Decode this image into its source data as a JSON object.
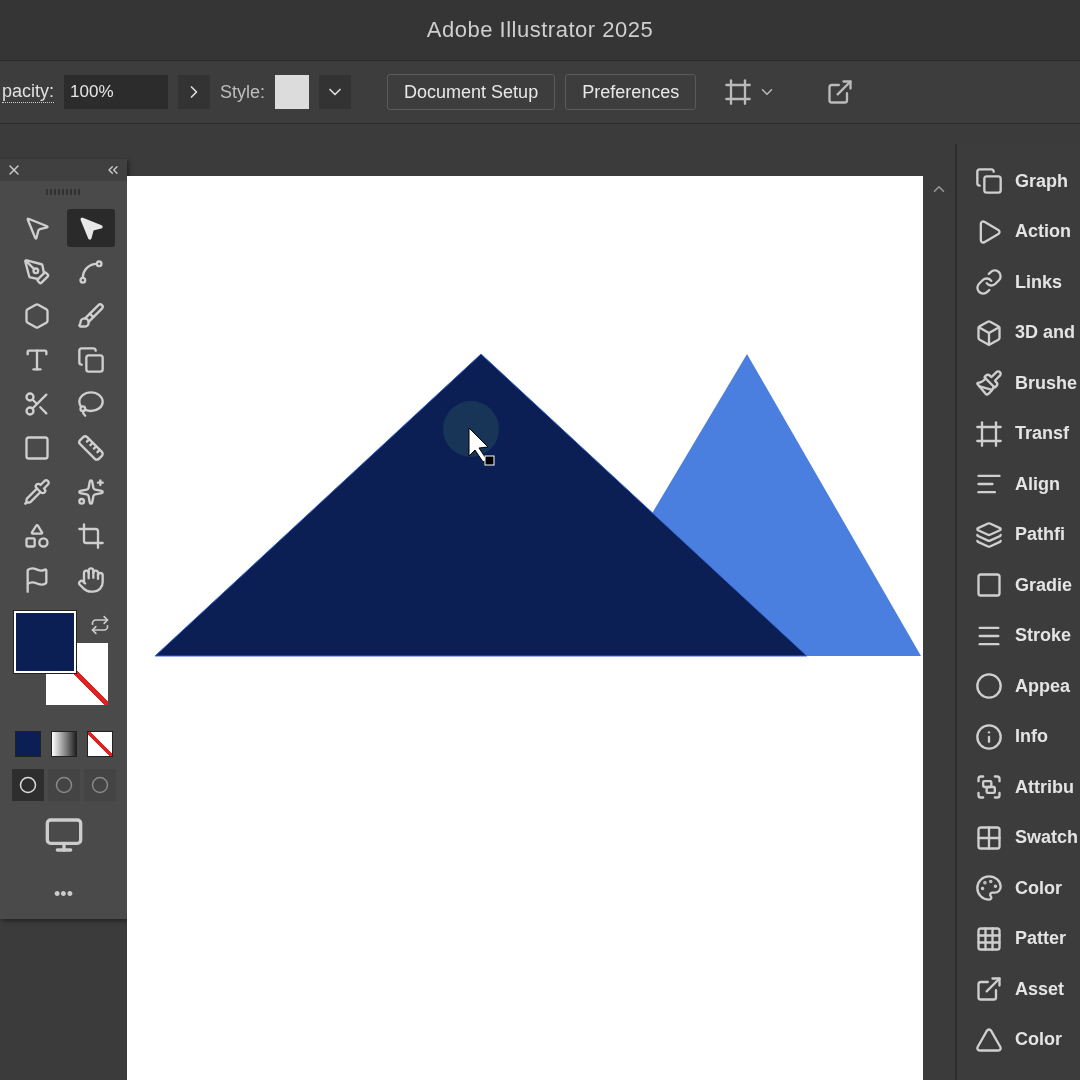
{
  "window": {
    "title": "Adobe Illustrator 2025"
  },
  "control_bar": {
    "opacity_label": "pacity:",
    "opacity_value": "100%",
    "style_label": "Style:",
    "buttons": [
      "Document Setup",
      "Preferences"
    ]
  },
  "tools": [
    {
      "selected": false
    },
    {
      "selected": true
    },
    {
      "selected": false
    },
    {
      "selected": false
    },
    {
      "selected": false
    },
    {
      "selected": false
    },
    {
      "selected": false
    },
    {
      "selected": false
    },
    {
      "selected": false
    },
    {
      "selected": false
    },
    {
      "selected": false
    },
    {
      "selected": false
    },
    {
      "selected": false
    },
    {
      "selected": false
    },
    {
      "selected": false
    },
    {
      "selected": false
    },
    {
      "selected": false
    },
    {
      "selected": false
    }
  ],
  "draw_modes": [
    {
      "selected": true
    },
    {
      "selected": false
    },
    {
      "selected": false
    }
  ],
  "more_label": "•••",
  "panels": [
    {
      "label": "Graph"
    },
    {
      "label": "Action"
    },
    {
      "label": "Links"
    },
    {
      "label": "3D and"
    },
    {
      "label": "Brushe"
    },
    {
      "label": "Transf"
    },
    {
      "label": "Align"
    },
    {
      "label": "Pathfi"
    },
    {
      "label": "Gradie"
    },
    {
      "label": "Stroke"
    },
    {
      "label": "Appea"
    },
    {
      "label": "Info"
    },
    {
      "label": "Attribu"
    },
    {
      "label": "Swatch"
    },
    {
      "label": "Color"
    },
    {
      "label": "Patter"
    },
    {
      "label": "Asset"
    },
    {
      "label": "Color"
    }
  ]
}
